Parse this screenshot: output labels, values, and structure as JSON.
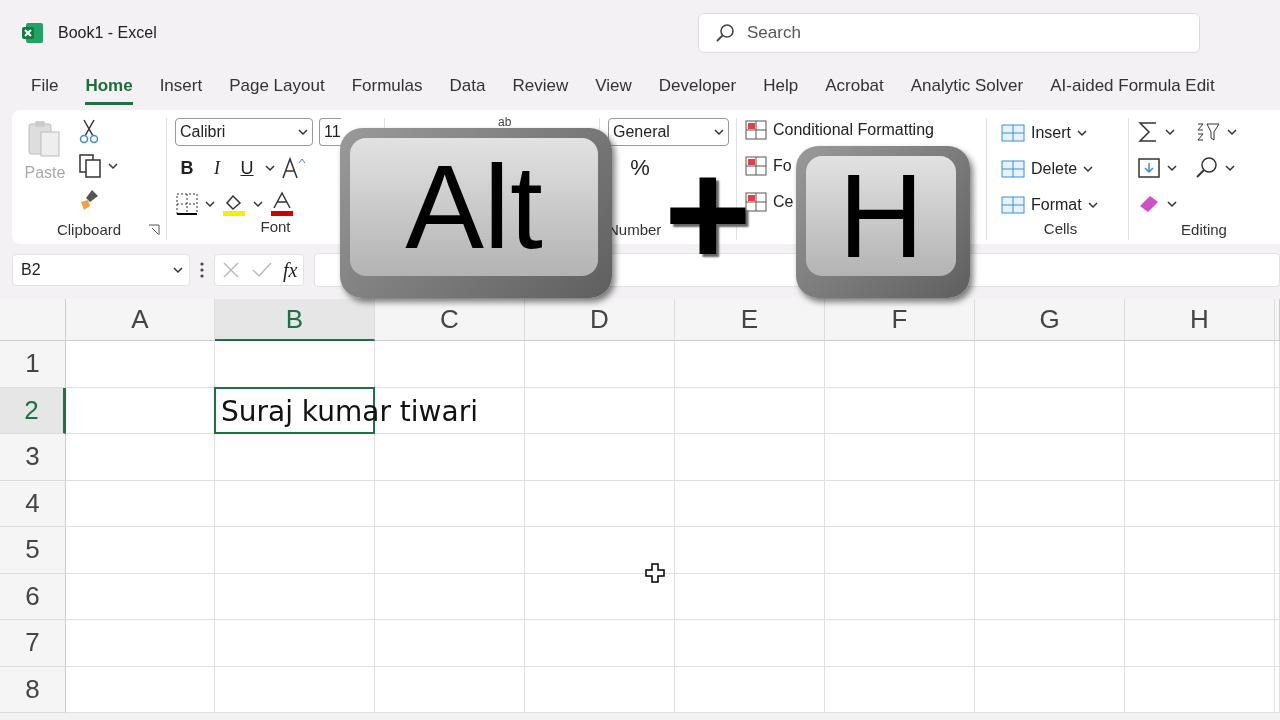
{
  "window": {
    "title": "Book1  -  Excel"
  },
  "search": {
    "placeholder": "Search"
  },
  "tabs": [
    {
      "label": "File",
      "selected": false
    },
    {
      "label": "Home",
      "selected": true
    },
    {
      "label": "Insert",
      "selected": false
    },
    {
      "label": "Page Layout",
      "selected": false
    },
    {
      "label": "Formulas",
      "selected": false
    },
    {
      "label": "Data",
      "selected": false
    },
    {
      "label": "Review",
      "selected": false
    },
    {
      "label": "View",
      "selected": false
    },
    {
      "label": "Developer",
      "selected": false
    },
    {
      "label": "Help",
      "selected": false
    },
    {
      "label": "Acrobat",
      "selected": false
    },
    {
      "label": "Analytic Solver",
      "selected": false
    },
    {
      "label": "AI-aided Formula Edit",
      "selected": false
    }
  ],
  "ribbon": {
    "clipboard": {
      "paste": "Paste",
      "label": "Clipboard"
    },
    "font": {
      "name": "Calibri",
      "size": "11",
      "styles": [
        "B",
        "I",
        "U"
      ],
      "label": "Font"
    },
    "alignment": {
      "wrap": "ab"
    },
    "number": {
      "format": "General",
      "percent": "%",
      "label": "Number"
    },
    "styles": {
      "items": [
        "Conditional Formatting",
        "Fo",
        "Ce"
      ]
    },
    "cells": {
      "items": [
        "Insert",
        "Delete",
        "Format"
      ],
      "label": "Cells"
    },
    "editing": {
      "label": "Editing"
    }
  },
  "formula_bar": {
    "name_box": "B2",
    "fx": "fx"
  },
  "grid": {
    "columns": [
      {
        "label": "A",
        "selected": false
      },
      {
        "label": "B",
        "selected": true
      },
      {
        "label": "C",
        "selected": false
      },
      {
        "label": "D",
        "selected": false
      },
      {
        "label": "E",
        "selected": false
      },
      {
        "label": "F",
        "selected": false
      },
      {
        "label": "G",
        "selected": false
      },
      {
        "label": "H",
        "selected": false
      }
    ],
    "rows": [
      {
        "label": "1",
        "selected": false
      },
      {
        "label": "2",
        "selected": true
      },
      {
        "label": "3",
        "selected": false
      },
      {
        "label": "4",
        "selected": false
      },
      {
        "label": "5",
        "selected": false
      },
      {
        "label": "6",
        "selected": false
      },
      {
        "label": "7",
        "selected": false
      },
      {
        "label": "8",
        "selected": false
      }
    ],
    "active_cell": {
      "value": "Suraj kumar tiwari"
    }
  },
  "key_overlay": {
    "keys": [
      "Alt",
      "H"
    ],
    "separator": "+"
  }
}
